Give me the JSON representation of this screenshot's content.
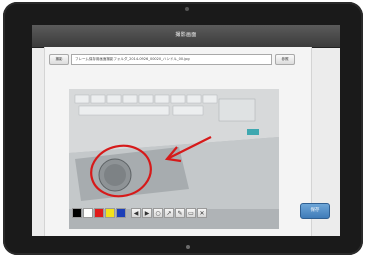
{
  "window": {
    "title": "撮影画面"
  },
  "toolbar_top": {
    "left_button_label": "撮影",
    "file_path": "フレーム保存用画面撮影フォルダ_2014-0926_00020_ハンドル_00.jpg",
    "right_button_label": "参照"
  },
  "colors": {
    "palette": [
      "#000000",
      "#ffffff",
      "#e01a1a",
      "#f2e21b",
      "#1c3fb8"
    ],
    "annotation": "#d61a1a"
  },
  "tools": [
    {
      "name": "undo-icon",
      "glyph": "◀"
    },
    {
      "name": "redo-icon",
      "glyph": "▶"
    },
    {
      "name": "circle-icon",
      "glyph": "○"
    },
    {
      "name": "arrow-icon",
      "glyph": "↗"
    },
    {
      "name": "pen-icon",
      "glyph": "✎"
    },
    {
      "name": "eraser-icon",
      "glyph": "▭"
    },
    {
      "name": "clear-icon",
      "glyph": "✕"
    }
  ],
  "actions": {
    "save_label": "保存"
  }
}
